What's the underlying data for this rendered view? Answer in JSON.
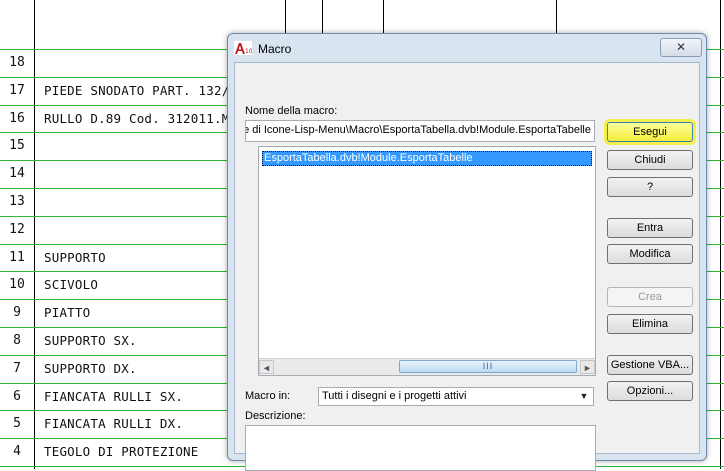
{
  "drawing": {
    "rows": [
      {
        "num": "18",
        "text": ""
      },
      {
        "num": "17",
        "text": "PIEDE SNODATO PART. 132/5297"
      },
      {
        "num": "16",
        "text": "RULLO D.89 Cod. 312011.M12 L"
      },
      {
        "num": "15",
        "text": ""
      },
      {
        "num": "14",
        "text": ""
      },
      {
        "num": "13",
        "text": ""
      },
      {
        "num": "12",
        "text": ""
      },
      {
        "num": "11",
        "text": "SUPPORTO"
      },
      {
        "num": "10",
        "text": "SCIVOLO"
      },
      {
        "num": "9",
        "text": "PIATTO"
      },
      {
        "num": "8",
        "text": "SUPPORTO SX."
      },
      {
        "num": "7",
        "text": "SUPPORTO DX."
      },
      {
        "num": "6",
        "text": "FIANCATA RULLI SX."
      },
      {
        "num": "5",
        "text": "FIANCATA RULLI DX."
      },
      {
        "num": "4",
        "text": "TEGOLO DI PROTEZIONE"
      }
    ]
  },
  "dialog": {
    "title": "Macro",
    "close_label": "✕",
    "macro_name_label": "Nome della macro:",
    "macro_name_value": "e di  Icone-Lisp-Menu\\Macro\\EsportaTabella.dvb!Module.EsportaTabelle",
    "list_items": [
      "EsportaTabella.dvb!Module.EsportaTabelle"
    ],
    "scroll_thumb_grip": "III",
    "scroll_left": "◄",
    "scroll_right": "►",
    "buttons": {
      "run": "Esegui",
      "close": "Chiudi",
      "help": "?",
      "step_into": "Entra",
      "edit": "Modifica",
      "create": "Crea",
      "delete": "Elimina",
      "vba_manager": "Gestione VBA...",
      "options": "Opzioni..."
    },
    "macro_in_label": "Macro in:",
    "macro_in_value": "Tutti i disegni e i progetti attivi",
    "description_label": "Descrizione:",
    "description_value": ""
  },
  "colors": {
    "grid_green": "#2fb52f",
    "highlight_yellow": "#f4ef4a",
    "selection_blue": "#3399ff"
  }
}
